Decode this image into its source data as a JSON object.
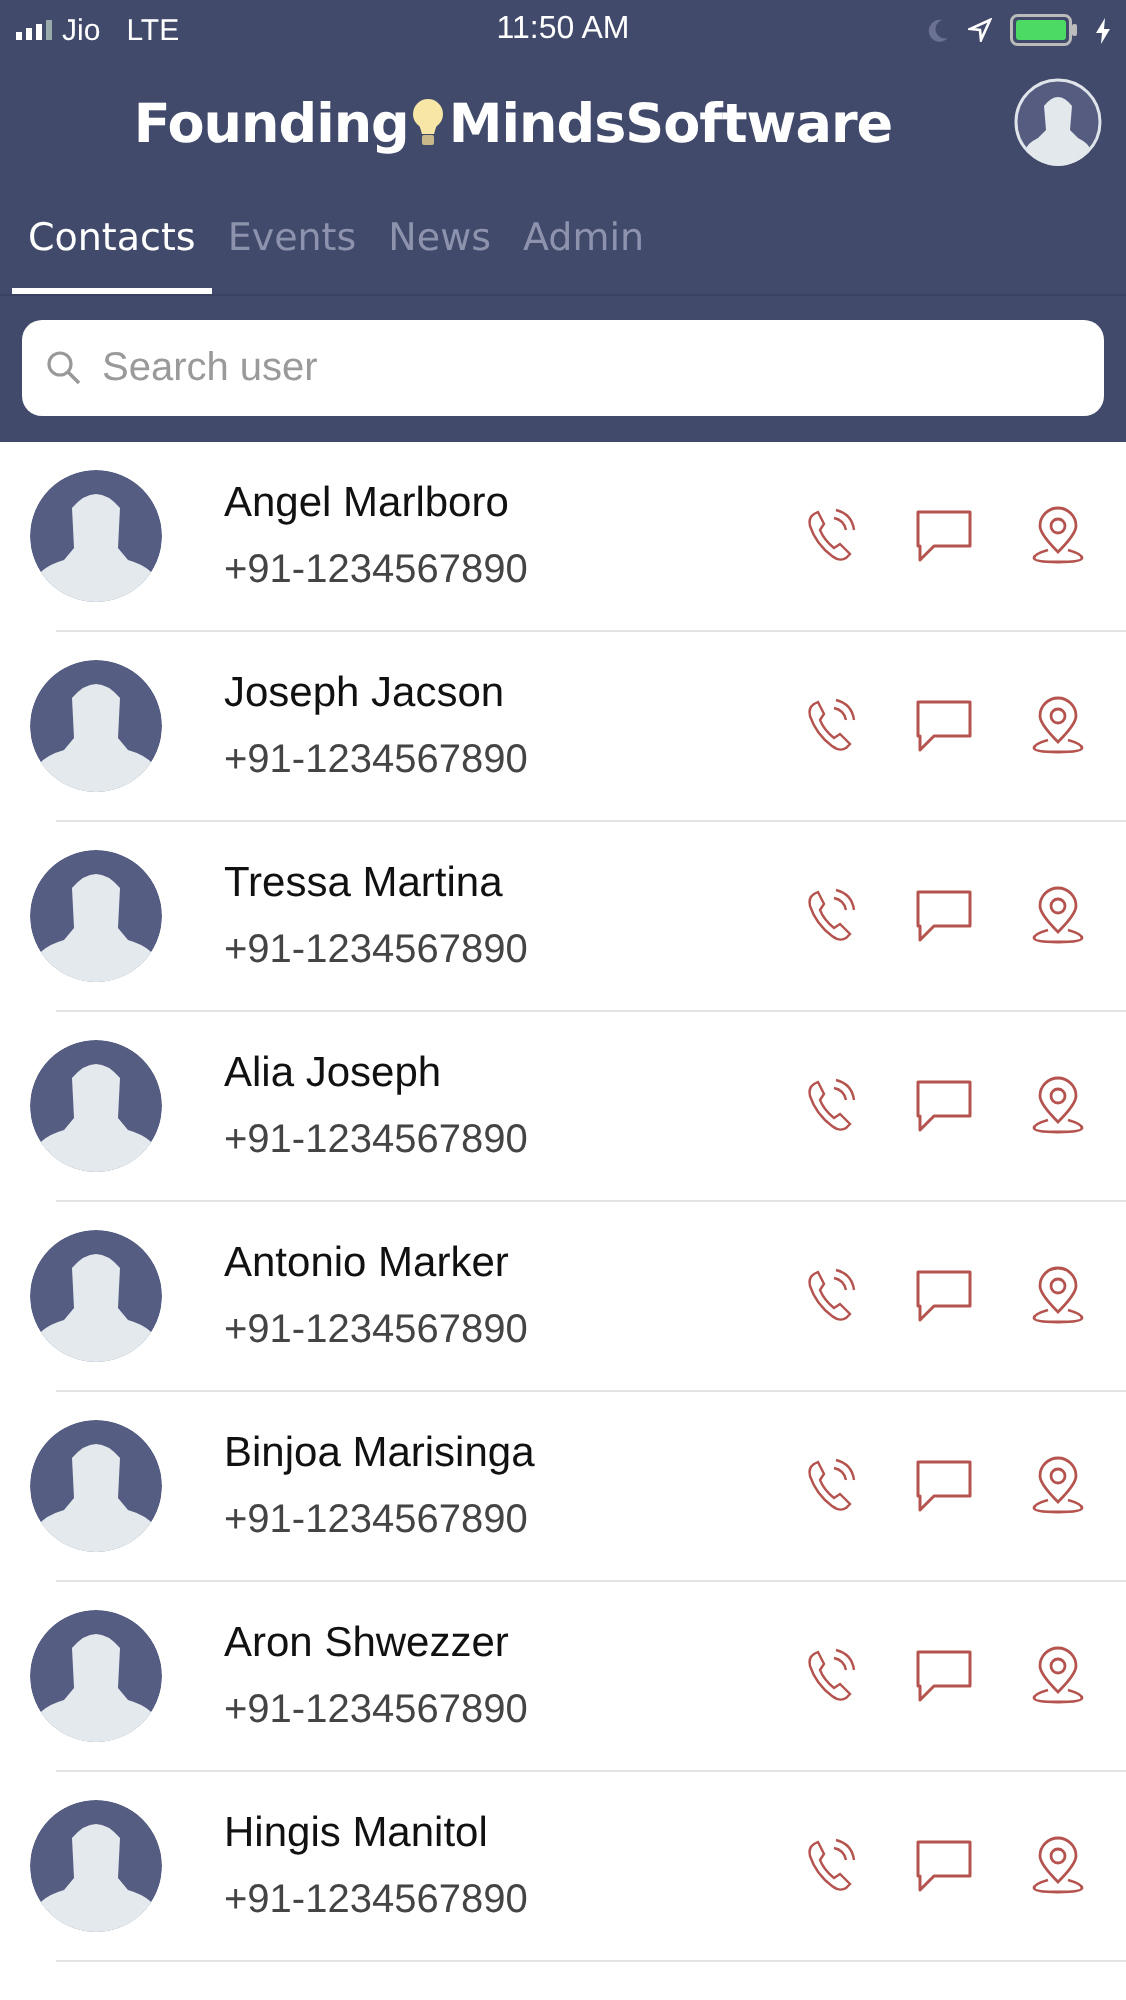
{
  "status_bar": {
    "carrier": "Jio",
    "network": "LTE",
    "time": "11:50 AM"
  },
  "header": {
    "brand_left": "Founding",
    "brand_right": "MindsSoftware"
  },
  "tabs": [
    {
      "label": "Contacts",
      "selected": true
    },
    {
      "label": "Events",
      "selected": false
    },
    {
      "label": "News",
      "selected": false
    },
    {
      "label": "Admin",
      "selected": false
    }
  ],
  "search": {
    "placeholder": "Search user"
  },
  "contacts": [
    {
      "name": "Angel Marlboro",
      "phone": "+91-1234567890"
    },
    {
      "name": "Joseph Jacson",
      "phone": "+91-1234567890"
    },
    {
      "name": "Tressa Martina",
      "phone": "+91-1234567890"
    },
    {
      "name": "Alia Joseph",
      "phone": "+91-1234567890"
    },
    {
      "name": "Antonio Marker",
      "phone": "+91-1234567890"
    },
    {
      "name": "Binjoa Marisinga",
      "phone": "+91-1234567890"
    },
    {
      "name": "Aron Shwezzer",
      "phone": "+91-1234567890"
    },
    {
      "name": "Hingis Manitol",
      "phone": "+91-1234567890"
    }
  ]
}
